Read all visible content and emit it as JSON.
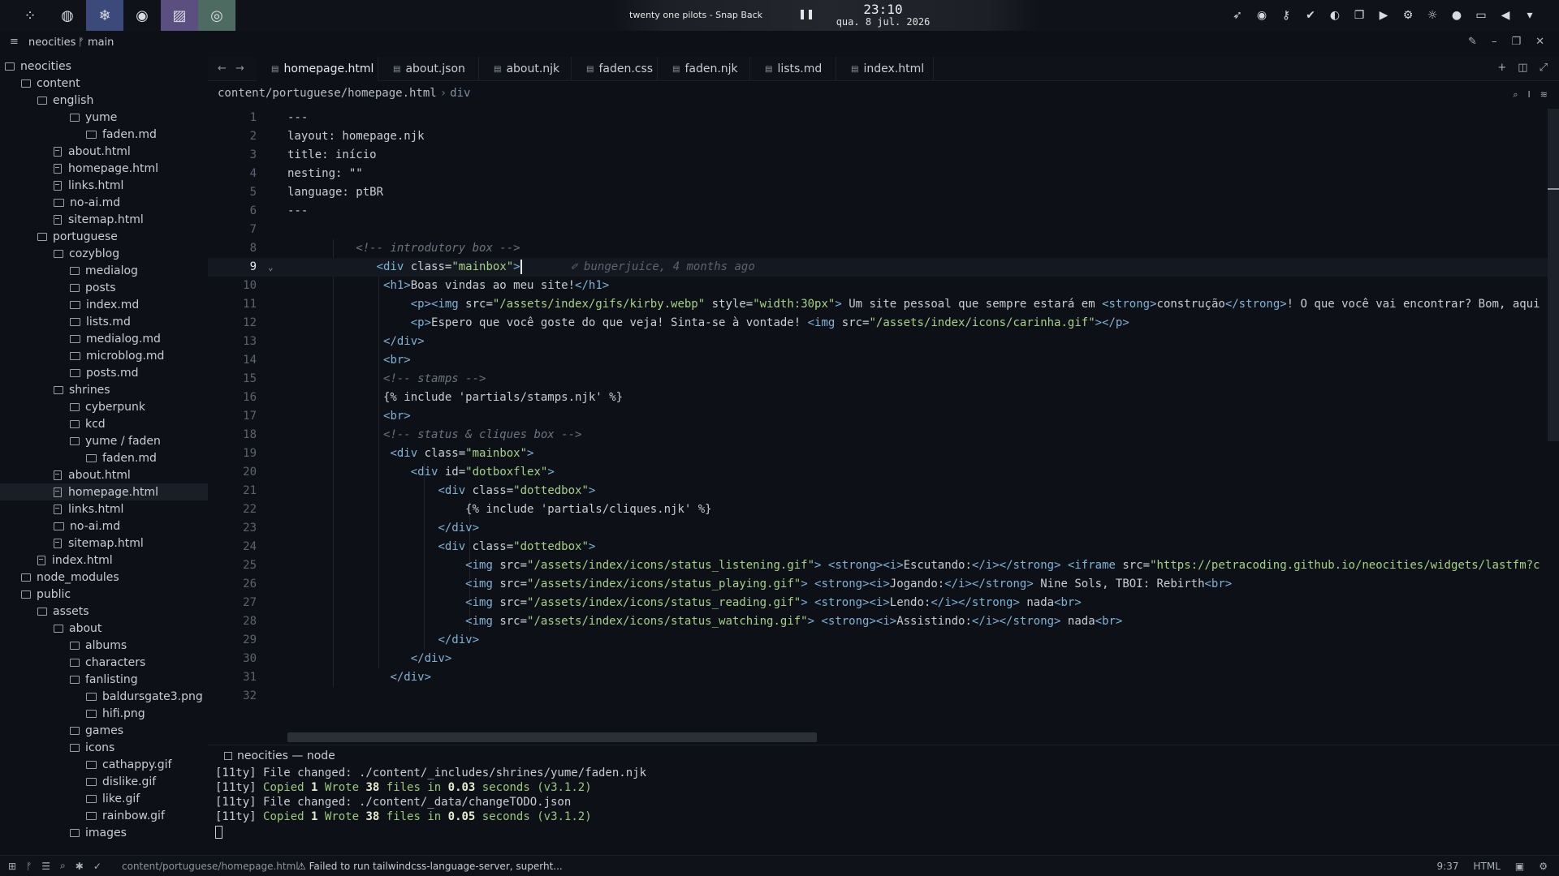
{
  "topbar": {
    "track": "twenty one pilots - Snap Back",
    "pause_icon": "pause-icon",
    "time": "23:10",
    "date": "qua. 8 jul. 2026",
    "left_icons": [
      "launcher-icon",
      "tor-icon",
      "snowflake-icon",
      "discord-icon",
      "editor-icon",
      "app-icon"
    ],
    "tray_icons": [
      "rocket-icon",
      "discord-icon",
      "key-icon",
      "check-icon",
      "steam-icon",
      "copy-icon",
      "media-icon",
      "settings-icon",
      "brightness-icon",
      "mic-icon",
      "screen-icon",
      "volume-icon",
      "chevron-down-icon"
    ]
  },
  "titlebar": {
    "project": "neocities",
    "branch": "main"
  },
  "sidebar": {
    "items": [
      {
        "label": "neocities",
        "kind": "folder",
        "depth": 0
      },
      {
        "label": "content",
        "kind": "folder",
        "depth": 1
      },
      {
        "label": "english",
        "kind": "folder",
        "depth": 2
      },
      {
        "label": "yume",
        "kind": "folder",
        "depth": 4
      },
      {
        "label": "faden.md",
        "kind": "md",
        "depth": 5
      },
      {
        "label": "about.html",
        "kind": "file",
        "depth": 3
      },
      {
        "label": "homepage.html",
        "kind": "file",
        "depth": 3
      },
      {
        "label": "links.html",
        "kind": "file",
        "depth": 3
      },
      {
        "label": "no-ai.md",
        "kind": "md",
        "depth": 3
      },
      {
        "label": "sitemap.html",
        "kind": "file",
        "depth": 3
      },
      {
        "label": "portuguese",
        "kind": "folder",
        "depth": 2
      },
      {
        "label": "cozyblog",
        "kind": "folder",
        "depth": 3
      },
      {
        "label": "medialog",
        "kind": "folder",
        "depth": 4
      },
      {
        "label": "posts",
        "kind": "folder",
        "depth": 4
      },
      {
        "label": "index.md",
        "kind": "md",
        "depth": 4
      },
      {
        "label": "lists.md",
        "kind": "md",
        "depth": 4
      },
      {
        "label": "medialog.md",
        "kind": "md",
        "depth": 4
      },
      {
        "label": "microblog.md",
        "kind": "md",
        "depth": 4
      },
      {
        "label": "posts.md",
        "kind": "md",
        "depth": 4
      },
      {
        "label": "shrines",
        "kind": "folder",
        "depth": 3
      },
      {
        "label": "cyberpunk",
        "kind": "folder",
        "depth": 4
      },
      {
        "label": "kcd",
        "kind": "folder",
        "depth": 4
      },
      {
        "label": "yume / faden",
        "kind": "folder",
        "depth": 4
      },
      {
        "label": "faden.md",
        "kind": "md",
        "depth": 5
      },
      {
        "label": "about.html",
        "kind": "file",
        "depth": 3
      },
      {
        "label": "homepage.html",
        "kind": "file",
        "depth": 3,
        "selected": true
      },
      {
        "label": "links.html",
        "kind": "file",
        "depth": 3
      },
      {
        "label": "no-ai.md",
        "kind": "md",
        "depth": 3
      },
      {
        "label": "sitemap.html",
        "kind": "file",
        "depth": 3
      },
      {
        "label": "index.html",
        "kind": "file",
        "depth": 2
      },
      {
        "label": "node_modules",
        "kind": "folder",
        "depth": 1
      },
      {
        "label": "public",
        "kind": "folder",
        "depth": 1
      },
      {
        "label": "assets",
        "kind": "folder",
        "depth": 2
      },
      {
        "label": "about",
        "kind": "folder",
        "depth": 3
      },
      {
        "label": "albums",
        "kind": "folder",
        "depth": 4
      },
      {
        "label": "characters",
        "kind": "folder",
        "depth": 4
      },
      {
        "label": "fanlisting",
        "kind": "folder",
        "depth": 4
      },
      {
        "label": "baldursgate3.png",
        "kind": "md",
        "depth": 5
      },
      {
        "label": "hifi.png",
        "kind": "md",
        "depth": 5
      },
      {
        "label": "games",
        "kind": "folder",
        "depth": 4
      },
      {
        "label": "icons",
        "kind": "folder",
        "depth": 4
      },
      {
        "label": "cathappy.gif",
        "kind": "md",
        "depth": 5
      },
      {
        "label": "dislike.gif",
        "kind": "md",
        "depth": 5
      },
      {
        "label": "like.gif",
        "kind": "md",
        "depth": 5
      },
      {
        "label": "rainbow.gif",
        "kind": "md",
        "depth": 5
      },
      {
        "label": "images",
        "kind": "folder",
        "depth": 4
      }
    ]
  },
  "tabs": [
    {
      "label": "homepage.html",
      "active": true
    },
    {
      "label": "about.json",
      "active": false
    },
    {
      "label": "about.njk",
      "active": false
    },
    {
      "label": "faden.css",
      "active": false
    },
    {
      "label": "faden.njk",
      "active": false
    },
    {
      "label": "lists.md",
      "active": false
    },
    {
      "label": "index.html",
      "active": false
    }
  ],
  "breadcrumb": {
    "path": "content/portuguese/homepage.html",
    "symbol": "div"
  },
  "editor": {
    "current_line": 9,
    "blame": "bungerjuice, 4 months ago",
    "lines": [
      [
        [
          "plain",
          "---"
        ]
      ],
      [
        [
          "plain",
          "layout: homepage.njk"
        ]
      ],
      [
        [
          "plain",
          "title: início"
        ]
      ],
      [
        [
          "plain",
          "nesting: \"\""
        ]
      ],
      [
        [
          "plain",
          "language: ptBR"
        ]
      ],
      [
        [
          "plain",
          "---"
        ]
      ],
      [],
      [
        [
          "plain",
          "          "
        ],
        [
          "com",
          "<!-- introdutory box -->"
        ]
      ],
      [
        [
          "plain",
          "             "
        ],
        [
          "tag",
          "<div "
        ],
        [
          "attr",
          "class="
        ],
        [
          "str",
          "\"mainbox\""
        ],
        [
          "tag",
          ">"
        ]
      ],
      [
        [
          "plain",
          "              "
        ],
        [
          "tag",
          "<h1>"
        ],
        [
          "plain",
          "Boas vindas ao meu site!"
        ],
        [
          "tag",
          "</h1>"
        ]
      ],
      [
        [
          "plain",
          "                  "
        ],
        [
          "tag",
          "<p><img "
        ],
        [
          "attr",
          "src="
        ],
        [
          "str",
          "\"/assets/index/gifs/kirby.webp\""
        ],
        [
          "attr",
          " style="
        ],
        [
          "str",
          "\"width:30px\""
        ],
        [
          "tag",
          ">"
        ],
        [
          "plain",
          " Um site pessoal que sempre estará em "
        ],
        [
          "tag",
          "<strong>"
        ],
        [
          "plain",
          "construção"
        ],
        [
          "tag",
          "</strong>"
        ],
        [
          "plain",
          "! O que você vai encontrar? Bom, aqui"
        ]
      ],
      [
        [
          "plain",
          "                  "
        ],
        [
          "tag",
          "<p>"
        ],
        [
          "plain",
          "Espero que você goste do que veja! Sinta-se à vontade! "
        ],
        [
          "tag",
          "<img "
        ],
        [
          "attr",
          "src="
        ],
        [
          "str",
          "\"/assets/index/icons/carinha.gif\""
        ],
        [
          "tag",
          "></p>"
        ]
      ],
      [
        [
          "plain",
          "              "
        ],
        [
          "tag",
          "</div>"
        ]
      ],
      [
        [
          "plain",
          "              "
        ],
        [
          "tag",
          "<br>"
        ]
      ],
      [
        [
          "plain",
          "              "
        ],
        [
          "com",
          "<!-- stamps -->"
        ]
      ],
      [
        [
          "plain",
          "              {% include 'partials/stamps.njk' %}"
        ]
      ],
      [
        [
          "plain",
          "              "
        ],
        [
          "tag",
          "<br>"
        ]
      ],
      [
        [
          "plain",
          "              "
        ],
        [
          "com",
          "<!-- status & cliques box -->"
        ]
      ],
      [
        [
          "plain",
          "               "
        ],
        [
          "tag",
          "<div "
        ],
        [
          "attr",
          "class="
        ],
        [
          "str",
          "\"mainbox\""
        ],
        [
          "tag",
          ">"
        ]
      ],
      [
        [
          "plain",
          "                  "
        ],
        [
          "tag",
          "<div "
        ],
        [
          "attr",
          "id="
        ],
        [
          "str",
          "\"dotboxflex\""
        ],
        [
          "tag",
          ">"
        ]
      ],
      [
        [
          "plain",
          "                      "
        ],
        [
          "tag",
          "<div "
        ],
        [
          "attr",
          "class="
        ],
        [
          "str",
          "\"dottedbox\""
        ],
        [
          "tag",
          ">"
        ]
      ],
      [
        [
          "plain",
          "                          {% include 'partials/cliques.njk' %}"
        ]
      ],
      [
        [
          "plain",
          "                      "
        ],
        [
          "tag",
          "</div>"
        ]
      ],
      [
        [
          "plain",
          "                      "
        ],
        [
          "tag",
          "<div "
        ],
        [
          "attr",
          "class="
        ],
        [
          "str",
          "\"dottedbox\""
        ],
        [
          "tag",
          ">"
        ]
      ],
      [
        [
          "plain",
          "                          "
        ],
        [
          "tag",
          "<img "
        ],
        [
          "attr",
          "src="
        ],
        [
          "str",
          "\"/assets/index/icons/status_listening.gif\""
        ],
        [
          "tag",
          "> <strong><i>"
        ],
        [
          "plain",
          "Escutando:"
        ],
        [
          "tag",
          "</i></strong> <iframe "
        ],
        [
          "attr",
          "src="
        ],
        [
          "str",
          "\"https://petracoding.github.io/neocities/widgets/lastfm?c"
        ]
      ],
      [
        [
          "plain",
          "                          "
        ],
        [
          "tag",
          "<img "
        ],
        [
          "attr",
          "src="
        ],
        [
          "str",
          "\"/assets/index/icons/status_playing.gif\""
        ],
        [
          "tag",
          "> <strong><i>"
        ],
        [
          "plain",
          "Jogando:"
        ],
        [
          "tag",
          "</i></strong>"
        ],
        [
          "plain",
          " Nine Sols, TBOI: Rebirth"
        ],
        [
          "tag",
          "<br>"
        ]
      ],
      [
        [
          "plain",
          "                          "
        ],
        [
          "tag",
          "<img "
        ],
        [
          "attr",
          "src="
        ],
        [
          "str",
          "\"/assets/index/icons/status_reading.gif\""
        ],
        [
          "tag",
          "> <strong><i>"
        ],
        [
          "plain",
          "Lendo:"
        ],
        [
          "tag",
          "</i></strong>"
        ],
        [
          "plain",
          " nada"
        ],
        [
          "tag",
          "<br>"
        ]
      ],
      [
        [
          "plain",
          "                          "
        ],
        [
          "tag",
          "<img "
        ],
        [
          "attr",
          "src="
        ],
        [
          "str",
          "\"/assets/index/icons/status_watching.gif\""
        ],
        [
          "tag",
          "> <strong><i>"
        ],
        [
          "plain",
          "Assistindo:"
        ],
        [
          "tag",
          "</i></strong>"
        ],
        [
          "plain",
          " nada"
        ],
        [
          "tag",
          "<br>"
        ]
      ],
      [
        [
          "plain",
          "                      "
        ],
        [
          "tag",
          "</div>"
        ]
      ],
      [
        [
          "plain",
          "                  "
        ],
        [
          "tag",
          "</div>"
        ]
      ],
      [
        [
          "plain",
          "               "
        ],
        [
          "tag",
          "</div>"
        ]
      ],
      []
    ]
  },
  "terminal": {
    "tab_label": "neocities — node",
    "lines": [
      [
        [
          "plain",
          "[11ty] File changed: ./content/_includes/shrines/yume/faden.njk"
        ]
      ],
      [
        [
          "plain",
          "[11ty] "
        ],
        [
          "g",
          "Copied "
        ],
        [
          "b",
          "1"
        ],
        [
          "g",
          " Wrote "
        ],
        [
          "b",
          "38"
        ],
        [
          "g",
          " files in "
        ],
        [
          "b",
          "0.03"
        ],
        [
          "g",
          " seconds (v3.1.2)"
        ]
      ],
      [
        [
          "plain",
          "[11ty] File changed: ./content/_data/changeTODO.json"
        ]
      ],
      [
        [
          "plain",
          "[11ty] "
        ],
        [
          "g",
          "Copied "
        ],
        [
          "b",
          "1"
        ],
        [
          "g",
          " Wrote "
        ],
        [
          "b",
          "38"
        ],
        [
          "g",
          " files in "
        ],
        [
          "b",
          "0.05"
        ],
        [
          "g",
          " seconds (v3.1.2)"
        ]
      ]
    ]
  },
  "statusbar": {
    "path": "content/portuguese/homepage.html",
    "warning": "Failed to run tailwindcss-language-server, superht...",
    "position": "9:37",
    "language": "HTML"
  }
}
